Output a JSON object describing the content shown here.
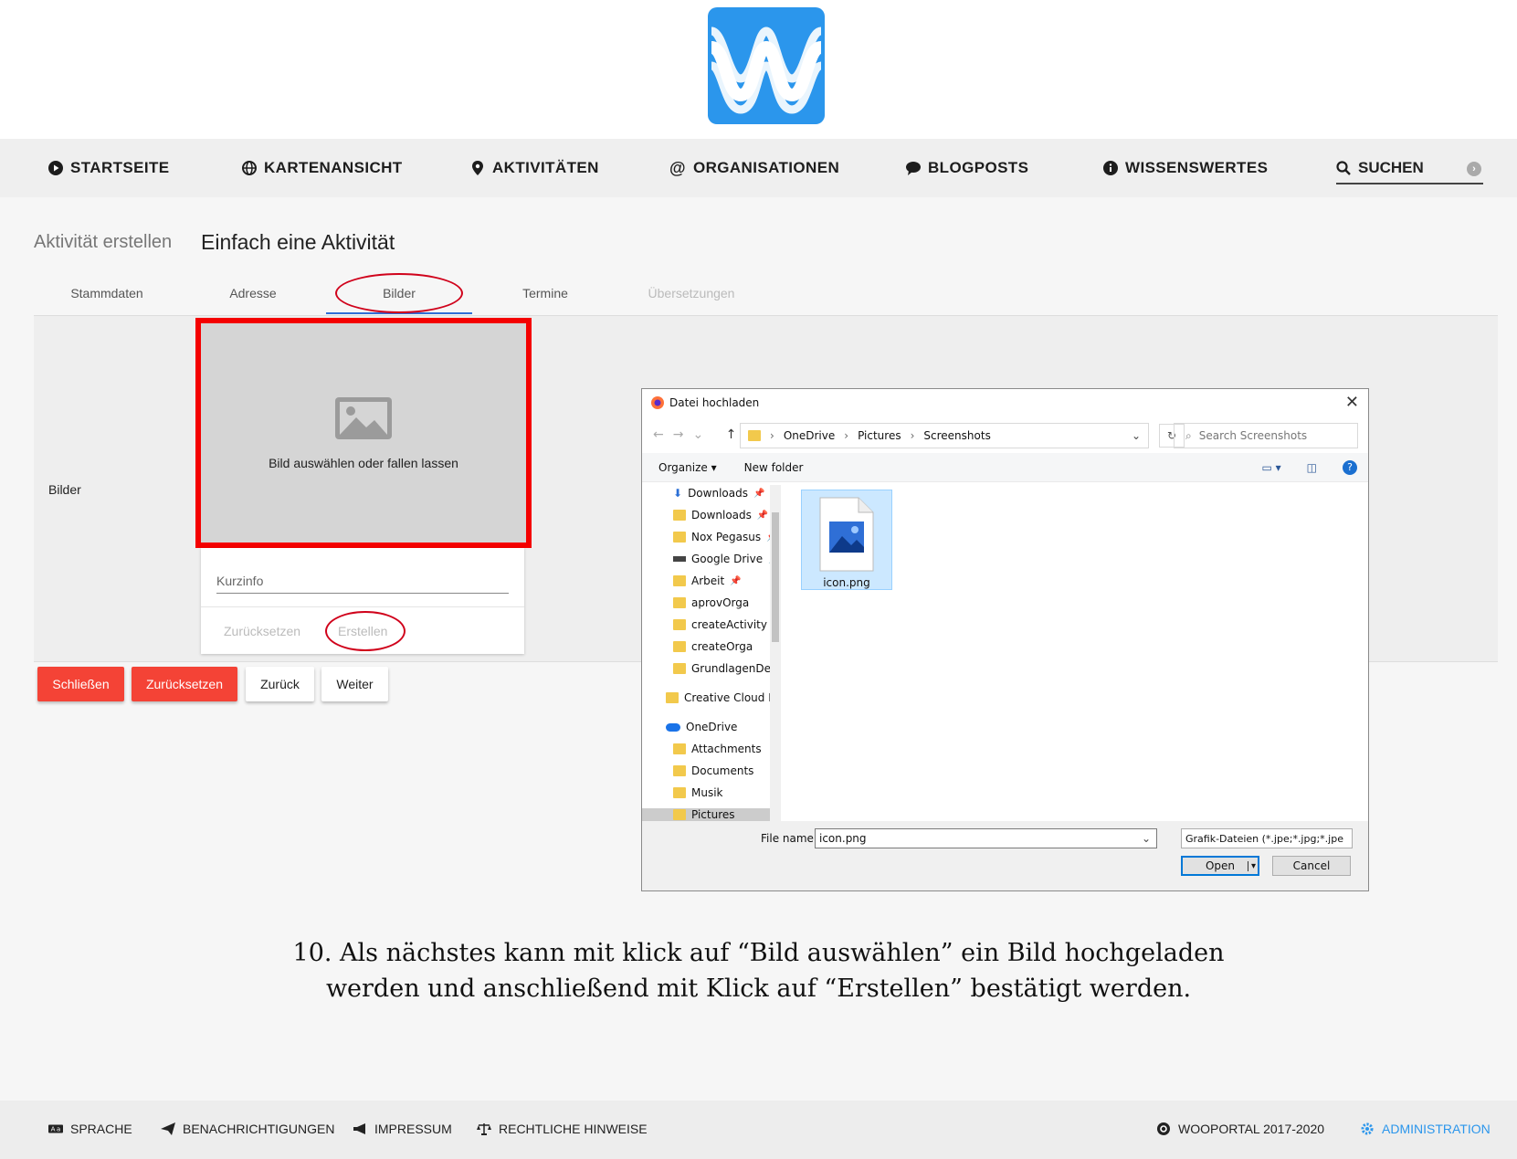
{
  "nav": {
    "items": [
      "STARTSEITE",
      "KARTENANSICHT",
      "AKTIVITÄTEN",
      "ORGANISATIONEN",
      "BLOGPOSTS",
      "WISSENSWERTES"
    ],
    "search_label": "SUCHEN"
  },
  "page": {
    "breadcrumb": "Aktivität erstellen",
    "title": "Einfach eine Aktivität",
    "tabs": [
      "Stammdaten",
      "Adresse",
      "Bilder",
      "Termine",
      "Übersetzungen"
    ]
  },
  "form": {
    "section_label": "Bilder",
    "dropzone_text": "Bild auswählen oder fallen lassen",
    "kurzinfo_placeholder": "Kurzinfo",
    "reset_label": "Zurücksetzen",
    "create_label": "Erstellen"
  },
  "actions": {
    "close": "Schließen",
    "reset": "Zurücksetzen",
    "back": "Zurück",
    "next": "Weiter"
  },
  "dialog": {
    "title": "Datei hochladen",
    "path": [
      "OneDrive",
      "Pictures",
      "Screenshots"
    ],
    "search_placeholder": "Search Screenshots",
    "organize": "Organize",
    "new_folder": "New folder",
    "tree": [
      "Downloads",
      "Downloads",
      "Nox Pegasus",
      "Google Drive",
      "Arbeit",
      "aprovOrga",
      "createActivity",
      "createOrga",
      "GrundlagenDerV",
      "Creative Cloud Fil",
      "OneDrive",
      "Attachments",
      "Documents",
      "Musik",
      "Pictures"
    ],
    "file": "icon.png",
    "file_name_label": "File name:",
    "file_name_value": "icon.png",
    "file_type": "Grafik-Dateien (*.jpe;*.jpg;*.jpe",
    "open": "Open",
    "cancel": "Cancel"
  },
  "caption": {
    "line1": "10. Als nächstes kann mit klick auf “Bild auswählen” ein Bild hochgeladen",
    "line2": "werden und anschließend mit Klick auf “Erstellen” bestätigt werden."
  },
  "footer": {
    "sprache": "SPRACHE",
    "benachrichtigungen": "BENACHRICHTIGUNGEN",
    "impressum": "IMPRESSUM",
    "rechtliche": "RECHTLICHE HINWEISE",
    "copyright": "WOOPORTAL 2017-2020",
    "admin": "ADMINISTRATION"
  },
  "colors": {
    "brand": "#2b96ec",
    "danger": "#f44336",
    "highlight": "#f40000"
  }
}
